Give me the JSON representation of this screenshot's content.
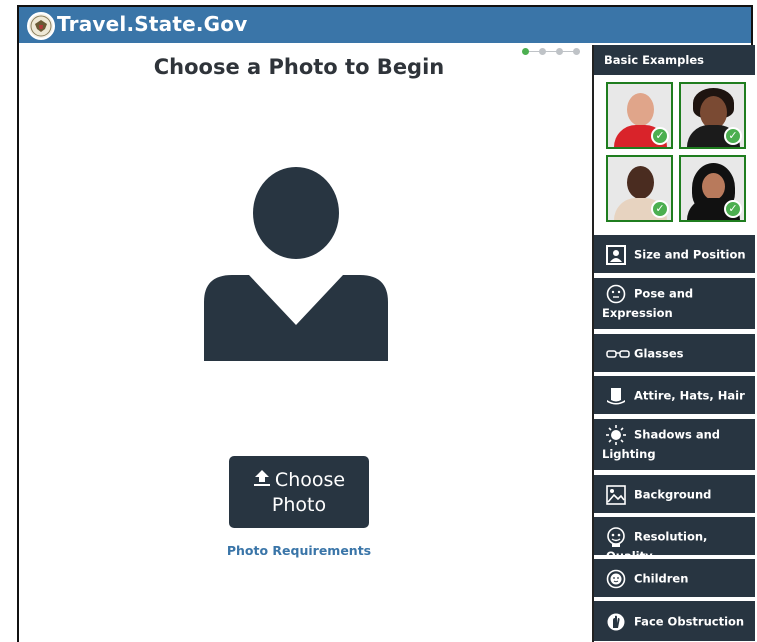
{
  "header": {
    "brand": "Travel.State.Gov"
  },
  "progress": {
    "steps": 4,
    "current_step": 1
  },
  "main": {
    "title": "Choose a Photo to Begin",
    "choose_button": {
      "line1": "Choose",
      "line2": "Photo"
    },
    "requirements_link": "Photo Requirements"
  },
  "sidebar": {
    "heading": "Basic Examples",
    "items": [
      {
        "label": "Size and Position",
        "icon": "portrait-icon"
      },
      {
        "label": "Pose and Expression",
        "icon": "face-icon"
      },
      {
        "label": "Glasses",
        "icon": "glasses-icon"
      },
      {
        "label": "Attire, Hats, Hair",
        "icon": "hat-icon"
      },
      {
        "label": "Shadows and Lighting",
        "icon": "sun-icon"
      },
      {
        "label": "Background",
        "icon": "image-icon"
      },
      {
        "label": "Resolution, Quality",
        "icon": "head-icon"
      },
      {
        "label": "Children",
        "icon": "baby-icon"
      },
      {
        "label": "Face Obstruction",
        "icon": "hand-icon"
      }
    ]
  },
  "colors": {
    "header": "#3a75a8",
    "dark_navy": "#283541",
    "accept_green": "#4caf50",
    "link": "#3a75a8"
  }
}
